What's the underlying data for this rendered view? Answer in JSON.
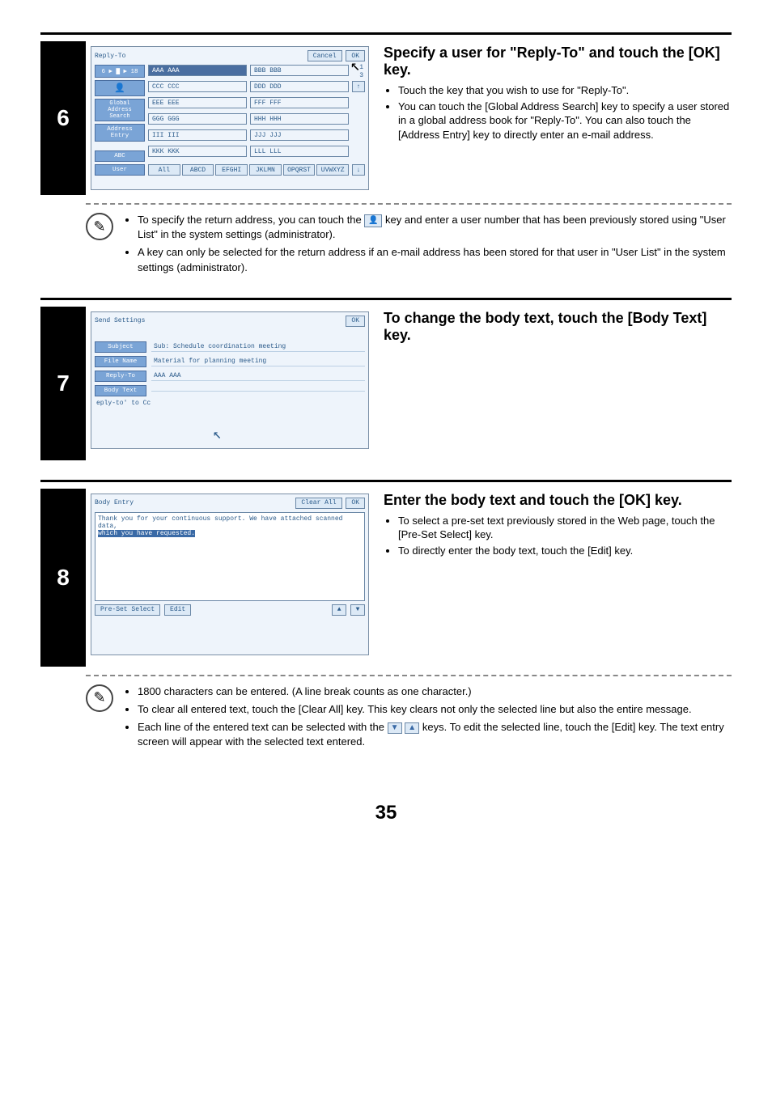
{
  "page_number": "35",
  "step6": {
    "number": "6",
    "heading": "Specify a user for \"Reply-To\" and touch the [OK] key.",
    "bullets": [
      "Touch the key that you wish to use for \"Reply-To\".",
      "You can touch the [Global Address Search] key to specify a user stored in a global address book for \"Reply-To\". You can also touch the [Address Entry] key to directly enter an e-mail address."
    ],
    "note_a_pre": "To specify the return address, you can touch the ",
    "note_a_post": " key and enter a user number that has been previously stored using \"User List\" in the system settings (administrator).",
    "note_b": "A key can only be selected for the return address if an e-mail address has been stored for that user in \"User List\" in the system settings (administrator).",
    "panel": {
      "title": "Reply-To",
      "cancel": "Cancel",
      "ok": "OK",
      "breadcrumb": "6 ▶ ▇ ▶ 18",
      "side": {
        "user_icon": "👤",
        "global": "Global Address Search",
        "address_entry": "Address Entry",
        "abc": "ABC",
        "user": "User"
      },
      "contacts": [
        [
          "AAA AAA",
          "BBB BBB"
        ],
        [
          "CCC CCC",
          "DDD DDD"
        ],
        [
          "EEE EEE",
          "FFF FFF"
        ],
        [
          "GGG GGG",
          "HHH HHH"
        ],
        [
          "III III",
          "JJJ JJJ"
        ],
        [
          "KKK KKK",
          "LLL LLL"
        ]
      ],
      "page_top": "1",
      "page_bottom": "3",
      "tabs": [
        "All",
        "ABCD",
        "EFGHI",
        "JKLMN",
        "OPQRST",
        "UVWXYZ"
      ]
    }
  },
  "step7": {
    "number": "7",
    "heading": "To change the body text, touch the [Body Text] key.",
    "panel": {
      "title": "Send Settings",
      "ok": "OK",
      "rows": [
        {
          "label": "Subject",
          "value": "Sub: Schedule coordination meeting"
        },
        {
          "label": "File Name",
          "value": "Material for planning meeting"
        },
        {
          "label": "Reply-To",
          "value": "AAA AAA"
        },
        {
          "label": "Body Text",
          "value": ""
        }
      ],
      "checkbox": "eply-to' to Cc"
    }
  },
  "step8": {
    "number": "8",
    "heading": "Enter the body text and touch the [OK] key.",
    "bullets": [
      "To select a pre-set text previously stored in the Web page, touch the [Pre-Set Select] key.",
      "To directly enter the body text, touch the [Edit] key."
    ],
    "note_a": "1800 characters can be entered. (A line break counts as one character.)",
    "note_b": "To clear all entered text, touch the [Clear All] key. This key clears not only the selected line but also the entire message.",
    "note_c_pre": "Each line of the entered text can be selected with the ",
    "note_c_post": " keys. To edit the selected line, touch the [Edit] key. The text entry screen will appear with the selected text entered.",
    "panel": {
      "title": "Body Entry",
      "clear_all": "Clear All",
      "ok": "OK",
      "line1": "Thank you for your continuous support. We have attached scanned data,",
      "line2_hl": "which you have requested.",
      "preset": "Pre-Set Select",
      "edit": "Edit"
    }
  }
}
